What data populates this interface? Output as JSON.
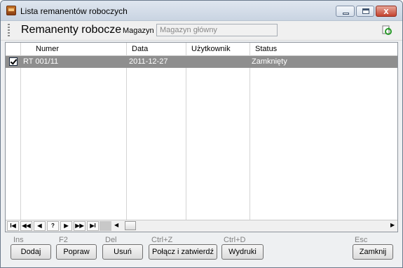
{
  "window": {
    "title": "Lista remanentów roboczych",
    "close_glyph": "x"
  },
  "toolbar": {
    "heading": "Remanenty robocze",
    "magazyn_label": "Magazyn",
    "magazyn_value": "Magazyn główny"
  },
  "grid": {
    "columns": [
      "Numer",
      "Data",
      "Użytkownik",
      "Status"
    ],
    "rows": [
      {
        "checked": true,
        "numer": "RT 001/11",
        "data": "2011-12-27",
        "uzytkownik": "",
        "status": "Zamknięty"
      }
    ],
    "nav": {
      "first": "I◀",
      "prev_page": "◀◀",
      "prev": "◀",
      "search": "?",
      "next": "▶",
      "next_page": "▶▶",
      "last": "▶I"
    }
  },
  "actions": {
    "dodaj": {
      "shortcut": "Ins",
      "label": "Dodaj"
    },
    "popraw": {
      "shortcut": "F2",
      "label": "Popraw"
    },
    "usun": {
      "shortcut": "Del",
      "label": "Usuń"
    },
    "polacz": {
      "shortcut": "Ctrl+Z",
      "label": "Połącz i zatwierdź"
    },
    "wydruki": {
      "shortcut": "Ctrl+D",
      "label": "Wydruki"
    },
    "zamknij": {
      "shortcut": "Esc",
      "label": "Zamknij"
    }
  },
  "colors": {
    "selected_row": "#8e8e8e",
    "close_button": "#c4432f"
  }
}
